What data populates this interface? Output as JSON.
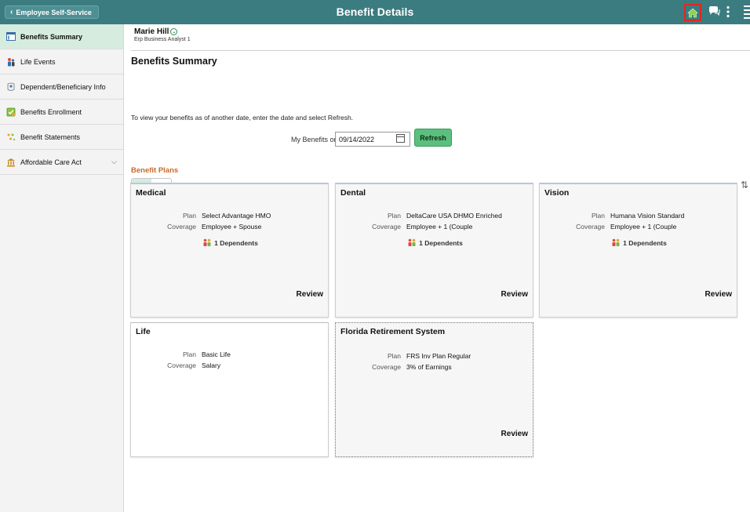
{
  "header": {
    "back_label": "Employee Self-Service",
    "title": "Benefit Details"
  },
  "colors": {
    "header_bg": "#3b7c80",
    "accent_green": "#5bbf7d",
    "section_orange": "#c8692a",
    "highlight_red": "#e0271f"
  },
  "sidebar": {
    "items": [
      {
        "label": "Benefits Summary",
        "icon": "benefits-summary-icon"
      },
      {
        "label": "Life Events",
        "icon": "life-events-icon"
      },
      {
        "label": "Dependent/Beneficiary Info",
        "icon": "dependent-icon"
      },
      {
        "label": "Benefits Enrollment",
        "icon": "enrollment-icon"
      },
      {
        "label": "Benefit Statements",
        "icon": "statements-icon"
      },
      {
        "label": "Affordable Care Act",
        "icon": "aca-icon"
      }
    ]
  },
  "user": {
    "name": "Marie Hill",
    "title": "Erp Business Analyst 1"
  },
  "main": {
    "section_title": "Benefits Summary",
    "instructions": "To view your benefits as of another date, enter the date and select Refresh.",
    "date_label": "My Benefits on",
    "date_value": "09/14/2022",
    "refresh_label": "Refresh",
    "plans_title": "Benefit Plans"
  },
  "cards": [
    {
      "title": "Medical",
      "plan_label": "Plan",
      "plan": "Select Advantage HMO",
      "coverage_label": "Coverage",
      "coverage": "Employee + Spouse",
      "dependents": "1 Dependents",
      "review": "Review"
    },
    {
      "title": "Dental",
      "plan_label": "Plan",
      "plan": "DeltaCare USA DHMO Enriched",
      "coverage_label": "Coverage",
      "coverage": "Employee + 1 (Couple",
      "dependents": "1 Dependents",
      "review": "Review"
    },
    {
      "title": "Vision",
      "plan_label": "Plan",
      "plan": "Humana Vision Standard",
      "coverage_label": "Coverage",
      "coverage": "Employee + 1 (Couple",
      "dependents": "1 Dependents",
      "review": "Review"
    },
    {
      "title": "Life",
      "plan_label": "Plan",
      "plan": "Basic Life",
      "coverage_label": "Coverage",
      "coverage": "Salary"
    },
    {
      "title": "Florida Retirement System",
      "plan_label": "Plan",
      "plan": "FRS Inv Plan Regular",
      "coverage_label": "Coverage",
      "coverage": "3% of Earnings",
      "review": "Review"
    }
  ]
}
